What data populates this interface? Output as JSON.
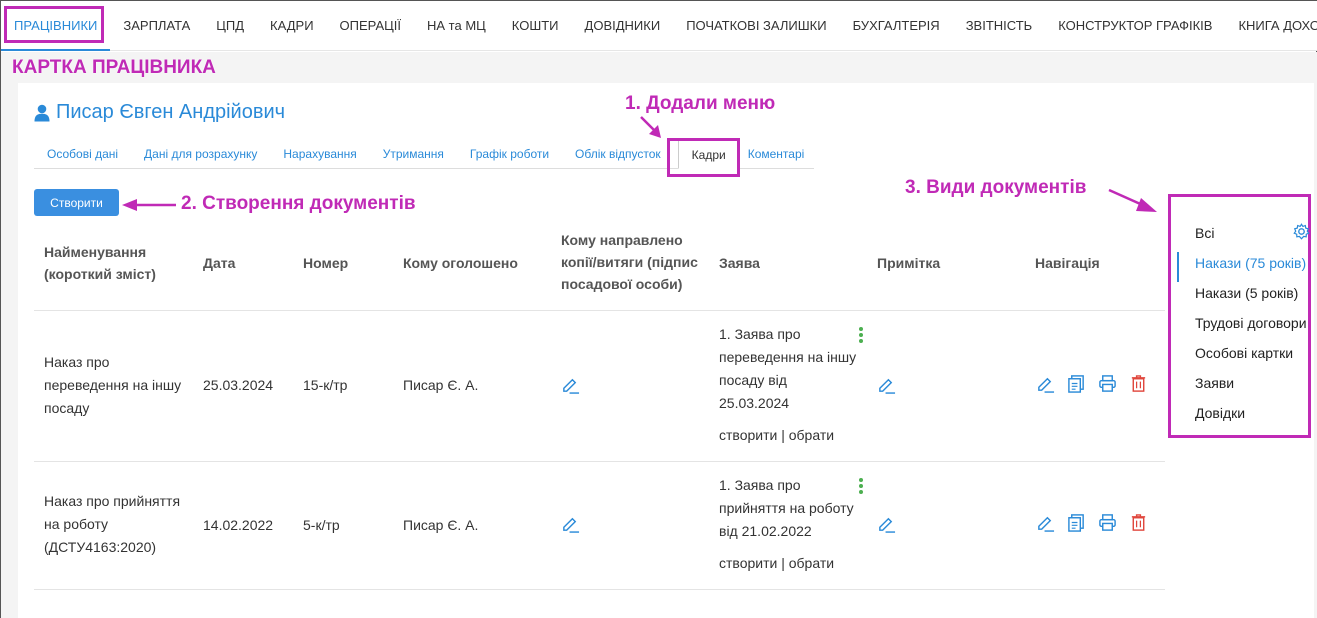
{
  "topnav": {
    "items": [
      {
        "label": "ПРАЦІВНИКИ"
      },
      {
        "label": "ЗАРПЛАТА"
      },
      {
        "label": "ЦПД"
      },
      {
        "label": "КАДРИ"
      },
      {
        "label": "ОПЕРАЦІЇ"
      },
      {
        "label": "НА та МЦ"
      },
      {
        "label": "КОШТИ"
      },
      {
        "label": "ДОВІДНИКИ"
      },
      {
        "label": "ПОЧАТКОВІ ЗАЛИШКИ"
      },
      {
        "label": "БУХГАЛТЕРІЯ"
      },
      {
        "label": "ЗВІТНІСТЬ"
      },
      {
        "label": "КОНСТРУКТОР ГРАФІКІВ"
      },
      {
        "label": "КНИГА ДОХОДІВ"
      }
    ]
  },
  "annotations": {
    "card_title": "КАРТКА ПРАЦІВНИКА",
    "added_menu": "1. Додали меню",
    "create_docs": "2. Створення документів",
    "doc_types": "3. Види документів"
  },
  "employee": {
    "name": "Писар Євген Андрійович"
  },
  "tabs": [
    {
      "label": "Особові дані"
    },
    {
      "label": "Дані для розрахунку"
    },
    {
      "label": "Нарахування"
    },
    {
      "label": "Утримання"
    },
    {
      "label": "Графік роботи"
    },
    {
      "label": "Облік відпусток"
    },
    {
      "label": "Кадри"
    },
    {
      "label": "Коментарі"
    }
  ],
  "create_button": "Створити",
  "table": {
    "headers": {
      "name_l1": "Найменування",
      "name_l2": "(короткий зміст)",
      "date": "Дата",
      "number": "Номер",
      "announced": "Кому оголошено",
      "copies_l1": "Кому направлено",
      "copies_l2": "копії/витяги (підпис",
      "copies_l3": "посадової особи)",
      "application": "Заява",
      "note": "Примітка",
      "navigation": "Навігація"
    },
    "rows": [
      {
        "name_l1": "Наказ про",
        "name_l2": "переведення на іншу",
        "name_l3": "посаду",
        "date": "25.03.2024",
        "number": "15-к/тр",
        "announced": "Писар Є. А.",
        "app_l1": "1. Заява про",
        "app_l2": "переведення на іншу",
        "app_l3": "посаду від",
        "app_l4": "25.03.2024",
        "create": "створити",
        "sep": " | ",
        "choose": "обрати"
      },
      {
        "name_l1": "Наказ про прийняття",
        "name_l2": "на роботу",
        "name_l3": "(ДСТУ4163:2020)",
        "date": "14.02.2022",
        "number": "5-к/тр",
        "announced": "Писар Є. А.",
        "app_l1": "1. Заява про",
        "app_l2": "прийняття на роботу",
        "app_l3": "від 21.02.2022",
        "app_l4": "",
        "create": "створити",
        "sep": " | ",
        "choose": "обрати"
      }
    ]
  },
  "sidepanel": {
    "items": [
      {
        "label": "Всі"
      },
      {
        "label": "Накази (75 років)"
      },
      {
        "label": "Накази (5 років)"
      },
      {
        "label": "Трудові договори"
      },
      {
        "label": "Особові картки"
      },
      {
        "label": "Заяви"
      },
      {
        "label": "Довідки"
      }
    ]
  },
  "colors": {
    "accent": "#2a8ad8",
    "highlight": "#c02ab6",
    "delete": "#e0463c",
    "dots": "#4caf50"
  }
}
